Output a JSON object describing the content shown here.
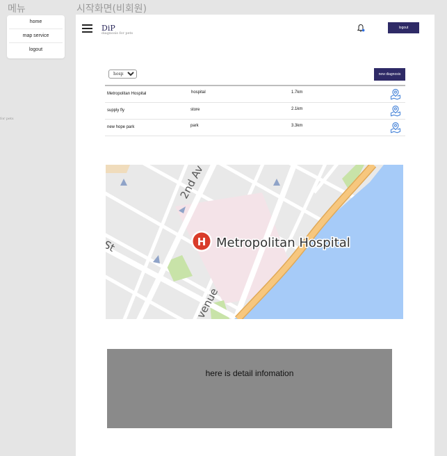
{
  "frames": {
    "menu_label": "메뉴",
    "start_label": "시작화면(비회원)"
  },
  "side_menu": {
    "items": [
      {
        "label": "home"
      },
      {
        "label": "map service"
      },
      {
        "label": "logout"
      }
    ]
  },
  "stray_text": "for pets",
  "header": {
    "logo": "DiP",
    "tagline": "diagnosis for pets",
    "logout_label": "logout"
  },
  "filter": {
    "selected": "hospital",
    "options": [
      "hospital"
    ]
  },
  "new_diagnosis_label": "new diagnosis",
  "places": [
    {
      "name": "Metropolitan Hospital",
      "type": "hospital",
      "distance": "1.7km"
    },
    {
      "name": "supply fly",
      "type": "store",
      "distance": "2.1km"
    },
    {
      "name": "new hope park",
      "type": "park",
      "distance": "3.3km"
    }
  ],
  "map": {
    "street_1": "2nd Av",
    "street_2": "St",
    "street_3": "venue",
    "place_label": "Metropolitan Hospital",
    "marker_letter": "H"
  },
  "detail": {
    "text": "here is detail infomation"
  },
  "colors": {
    "brand": "#2e2a66",
    "pin": "#4a86d9",
    "marker": "#d93c2a",
    "water": "#a6cbf8",
    "highway": "#f7c77e"
  }
}
